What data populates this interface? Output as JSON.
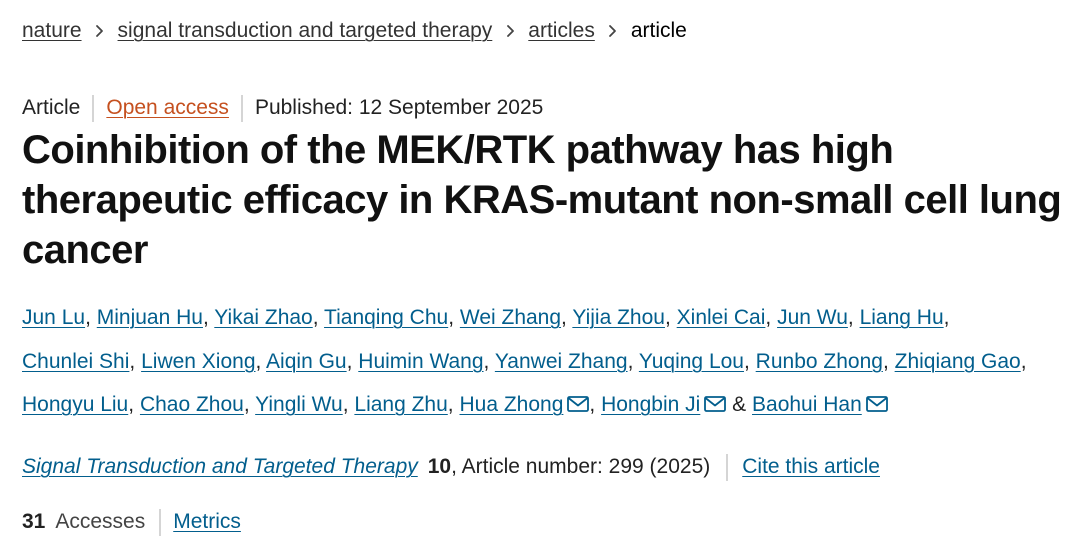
{
  "breadcrumb": {
    "items": [
      "nature",
      "signal transduction and targeted therapy",
      "articles"
    ],
    "current": "article"
  },
  "meta": {
    "type": "Article",
    "access": "Open access",
    "published": "Published: 12 September 2025"
  },
  "title": "Coinhibition of the MEK/RTK pathway has high therapeutic efficacy in KRAS-mutant non-small cell lung cancer",
  "authors": [
    {
      "name": "Jun Lu"
    },
    {
      "name": "Minjuan Hu"
    },
    {
      "name": "Yikai Zhao"
    },
    {
      "name": "Tianqing Chu"
    },
    {
      "name": "Wei Zhang"
    },
    {
      "name": "Yijia Zhou"
    },
    {
      "name": "Xinlei Cai"
    },
    {
      "name": "Jun Wu"
    },
    {
      "name": "Liang Hu"
    },
    {
      "name": "Chunlei Shi"
    },
    {
      "name": "Liwen Xiong"
    },
    {
      "name": "Aiqin Gu"
    },
    {
      "name": "Huimin Wang"
    },
    {
      "name": "Yanwei Zhang"
    },
    {
      "name": "Yuqing Lou"
    },
    {
      "name": "Runbo Zhong"
    },
    {
      "name": "Zhiqiang Gao"
    },
    {
      "name": "Hongyu Liu"
    },
    {
      "name": "Chao Zhou"
    },
    {
      "name": "Yingli Wu"
    },
    {
      "name": "Liang Zhu"
    },
    {
      "name": "Hua Zhong",
      "email_icon": "mail-icon"
    },
    {
      "name": "Hongbin Ji",
      "email_icon": "mail-icon"
    },
    {
      "name": "Baohui Han",
      "email_icon": "mail-icon"
    }
  ],
  "author_separator": ",",
  "author_last_separator": "&",
  "citation": {
    "journal": "Signal Transduction and Targeted Therapy",
    "volume": "10",
    "article_number": ", Article number: 299 (2025)",
    "cite_label": "Cite this article"
  },
  "metrics": {
    "accesses_count": "31",
    "accesses_label": "Accesses",
    "metrics_label": "Metrics"
  },
  "colors": {
    "link": "#025e8d",
    "open_access": "#c5501f",
    "text": "#222222"
  }
}
